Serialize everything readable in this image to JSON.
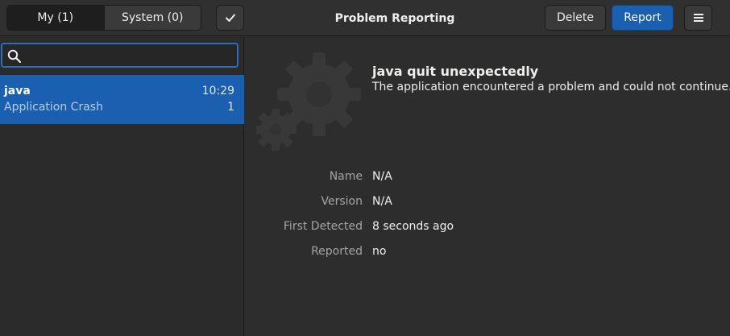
{
  "header": {
    "title": "Problem Reporting",
    "tabs": [
      {
        "label": "My (1)",
        "active": true
      },
      {
        "label": "System (0)",
        "active": false
      }
    ],
    "select_icon": "checkmark-icon",
    "delete_label": "Delete",
    "report_label": "Report",
    "menu_icon": "hamburger-menu-icon"
  },
  "sidebar": {
    "search": {
      "value": "",
      "placeholder": ""
    },
    "problems": [
      {
        "name": "java",
        "time": "10:29",
        "type": "Application Crash",
        "count": "1",
        "selected": true
      }
    ]
  },
  "detail": {
    "title": "java quit unexpectedly",
    "description": "The application encountered a problem and could not continue.",
    "icon": "gear-icon",
    "fields": [
      {
        "label": "Name",
        "value": "N/A"
      },
      {
        "label": "Version",
        "value": "N/A"
      },
      {
        "label": "First Detected",
        "value": "8 seconds ago"
      },
      {
        "label": "Reported",
        "value": "no"
      }
    ]
  },
  "colors": {
    "accent": "#1b5fb0",
    "background": "#2d2d2d",
    "headerbar": "#303030"
  }
}
